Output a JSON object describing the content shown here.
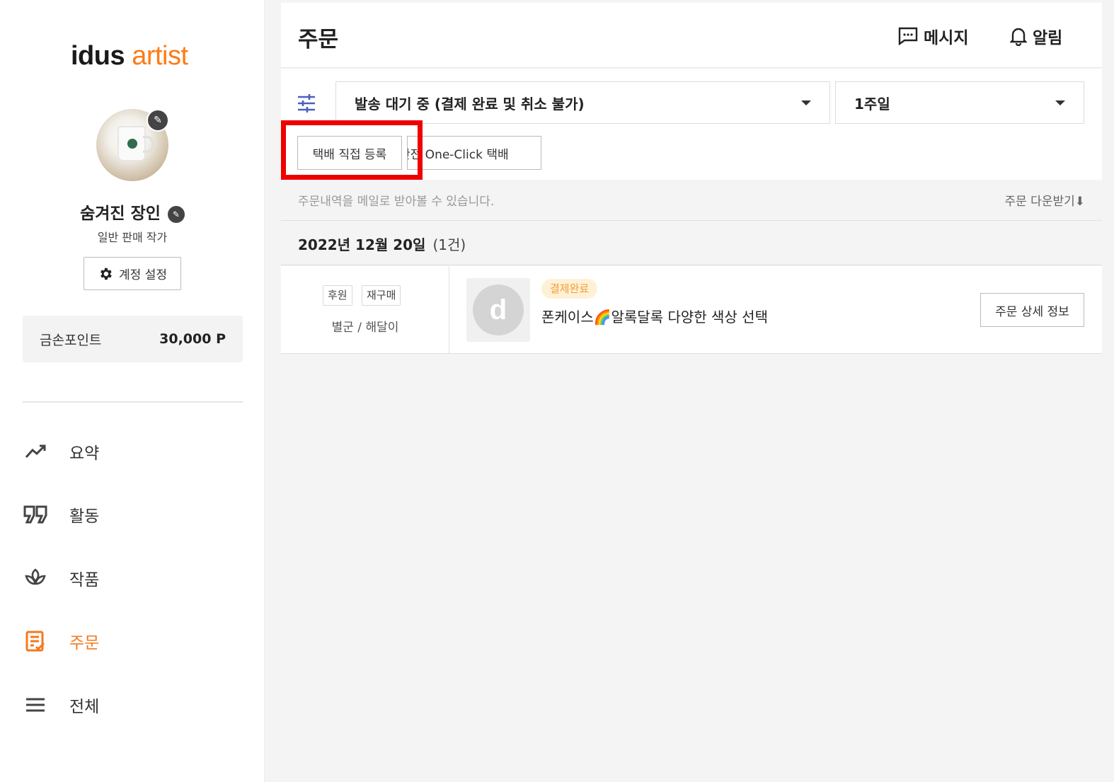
{
  "sidebar": {
    "logo_part1": "idus",
    "logo_part2": "artist",
    "artist_name": "숨겨진 장인",
    "artist_type": "일반 판매 작가",
    "settings_label": "계정 설정",
    "points_label": "금손포인트",
    "points_value": "30,000 P",
    "nav": [
      {
        "label": "요약",
        "icon": "trend-icon"
      },
      {
        "label": "활동",
        "icon": "quote-icon"
      },
      {
        "label": "작품",
        "icon": "leaf-icon"
      },
      {
        "label": "주문",
        "icon": "order-icon",
        "active": true
      },
      {
        "label": "전체",
        "icon": "menu-icon"
      }
    ]
  },
  "header": {
    "title": "주문",
    "message_label": "메시지",
    "alarm_label": "알림"
  },
  "filters": {
    "status_selected": "발송 대기 중 (결제 완료 및 취소 불가)",
    "period_selected": "1주일",
    "direct_ship_label": "택배 직접 등록",
    "oneclick_label": "안전 One-Click 택배"
  },
  "mail": {
    "notice": "주문내역을 메일로 받아볼 수 있습니다.",
    "download_label": "주문 다운받기"
  },
  "order_group": {
    "date": "2022년 12월 20일",
    "count": "(1건)"
  },
  "order": {
    "tag1": "후원",
    "tag2": "재구매",
    "recipient": "별군 / 해달이",
    "status": "결제완료",
    "product": "폰케이스🌈알록달록 다양한 색상 선택",
    "detail_label": "주문 상세 정보"
  },
  "colors": {
    "accent": "#f5781e",
    "highlight": "#ee0000"
  }
}
